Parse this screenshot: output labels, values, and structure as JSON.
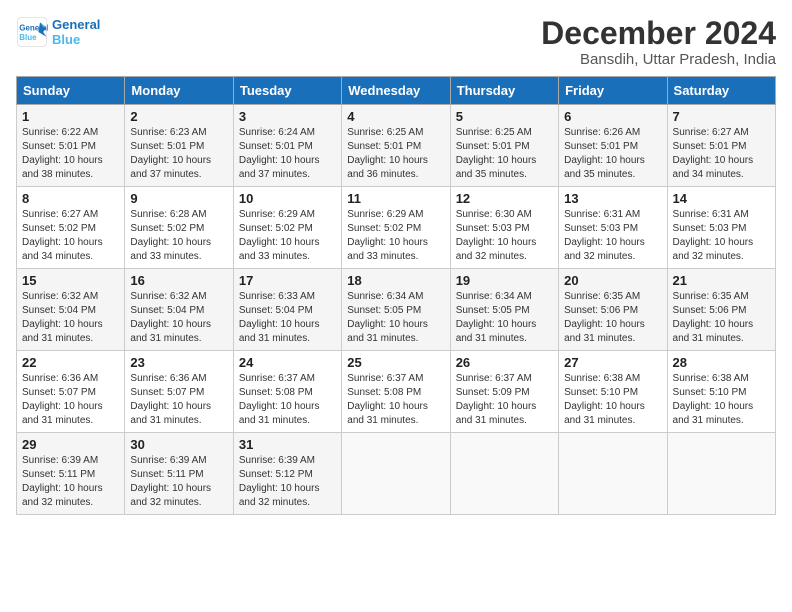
{
  "logo": {
    "line1": "General",
    "line2": "Blue"
  },
  "title": "December 2024",
  "subtitle": "Bansdih, Uttar Pradesh, India",
  "weekdays": [
    "Sunday",
    "Monday",
    "Tuesday",
    "Wednesday",
    "Thursday",
    "Friday",
    "Saturday"
  ],
  "weeks": [
    [
      {
        "day": "1",
        "detail": "Sunrise: 6:22 AM\nSunset: 5:01 PM\nDaylight: 10 hours\nand 38 minutes."
      },
      {
        "day": "2",
        "detail": "Sunrise: 6:23 AM\nSunset: 5:01 PM\nDaylight: 10 hours\nand 37 minutes."
      },
      {
        "day": "3",
        "detail": "Sunrise: 6:24 AM\nSunset: 5:01 PM\nDaylight: 10 hours\nand 37 minutes."
      },
      {
        "day": "4",
        "detail": "Sunrise: 6:25 AM\nSunset: 5:01 PM\nDaylight: 10 hours\nand 36 minutes."
      },
      {
        "day": "5",
        "detail": "Sunrise: 6:25 AM\nSunset: 5:01 PM\nDaylight: 10 hours\nand 35 minutes."
      },
      {
        "day": "6",
        "detail": "Sunrise: 6:26 AM\nSunset: 5:01 PM\nDaylight: 10 hours\nand 35 minutes."
      },
      {
        "day": "7",
        "detail": "Sunrise: 6:27 AM\nSunset: 5:01 PM\nDaylight: 10 hours\nand 34 minutes."
      }
    ],
    [
      {
        "day": "8",
        "detail": "Sunrise: 6:27 AM\nSunset: 5:02 PM\nDaylight: 10 hours\nand 34 minutes."
      },
      {
        "day": "9",
        "detail": "Sunrise: 6:28 AM\nSunset: 5:02 PM\nDaylight: 10 hours\nand 33 minutes."
      },
      {
        "day": "10",
        "detail": "Sunrise: 6:29 AM\nSunset: 5:02 PM\nDaylight: 10 hours\nand 33 minutes."
      },
      {
        "day": "11",
        "detail": "Sunrise: 6:29 AM\nSunset: 5:02 PM\nDaylight: 10 hours\nand 33 minutes."
      },
      {
        "day": "12",
        "detail": "Sunrise: 6:30 AM\nSunset: 5:03 PM\nDaylight: 10 hours\nand 32 minutes."
      },
      {
        "day": "13",
        "detail": "Sunrise: 6:31 AM\nSunset: 5:03 PM\nDaylight: 10 hours\nand 32 minutes."
      },
      {
        "day": "14",
        "detail": "Sunrise: 6:31 AM\nSunset: 5:03 PM\nDaylight: 10 hours\nand 32 minutes."
      }
    ],
    [
      {
        "day": "15",
        "detail": "Sunrise: 6:32 AM\nSunset: 5:04 PM\nDaylight: 10 hours\nand 31 minutes."
      },
      {
        "day": "16",
        "detail": "Sunrise: 6:32 AM\nSunset: 5:04 PM\nDaylight: 10 hours\nand 31 minutes."
      },
      {
        "day": "17",
        "detail": "Sunrise: 6:33 AM\nSunset: 5:04 PM\nDaylight: 10 hours\nand 31 minutes."
      },
      {
        "day": "18",
        "detail": "Sunrise: 6:34 AM\nSunset: 5:05 PM\nDaylight: 10 hours\nand 31 minutes."
      },
      {
        "day": "19",
        "detail": "Sunrise: 6:34 AM\nSunset: 5:05 PM\nDaylight: 10 hours\nand 31 minutes."
      },
      {
        "day": "20",
        "detail": "Sunrise: 6:35 AM\nSunset: 5:06 PM\nDaylight: 10 hours\nand 31 minutes."
      },
      {
        "day": "21",
        "detail": "Sunrise: 6:35 AM\nSunset: 5:06 PM\nDaylight: 10 hours\nand 31 minutes."
      }
    ],
    [
      {
        "day": "22",
        "detail": "Sunrise: 6:36 AM\nSunset: 5:07 PM\nDaylight: 10 hours\nand 31 minutes."
      },
      {
        "day": "23",
        "detail": "Sunrise: 6:36 AM\nSunset: 5:07 PM\nDaylight: 10 hours\nand 31 minutes."
      },
      {
        "day": "24",
        "detail": "Sunrise: 6:37 AM\nSunset: 5:08 PM\nDaylight: 10 hours\nand 31 minutes."
      },
      {
        "day": "25",
        "detail": "Sunrise: 6:37 AM\nSunset: 5:08 PM\nDaylight: 10 hours\nand 31 minutes."
      },
      {
        "day": "26",
        "detail": "Sunrise: 6:37 AM\nSunset: 5:09 PM\nDaylight: 10 hours\nand 31 minutes."
      },
      {
        "day": "27",
        "detail": "Sunrise: 6:38 AM\nSunset: 5:10 PM\nDaylight: 10 hours\nand 31 minutes."
      },
      {
        "day": "28",
        "detail": "Sunrise: 6:38 AM\nSunset: 5:10 PM\nDaylight: 10 hours\nand 31 minutes."
      }
    ],
    [
      {
        "day": "29",
        "detail": "Sunrise: 6:39 AM\nSunset: 5:11 PM\nDaylight: 10 hours\nand 32 minutes."
      },
      {
        "day": "30",
        "detail": "Sunrise: 6:39 AM\nSunset: 5:11 PM\nDaylight: 10 hours\nand 32 minutes."
      },
      {
        "day": "31",
        "detail": "Sunrise: 6:39 AM\nSunset: 5:12 PM\nDaylight: 10 hours\nand 32 minutes."
      },
      null,
      null,
      null,
      null
    ]
  ]
}
